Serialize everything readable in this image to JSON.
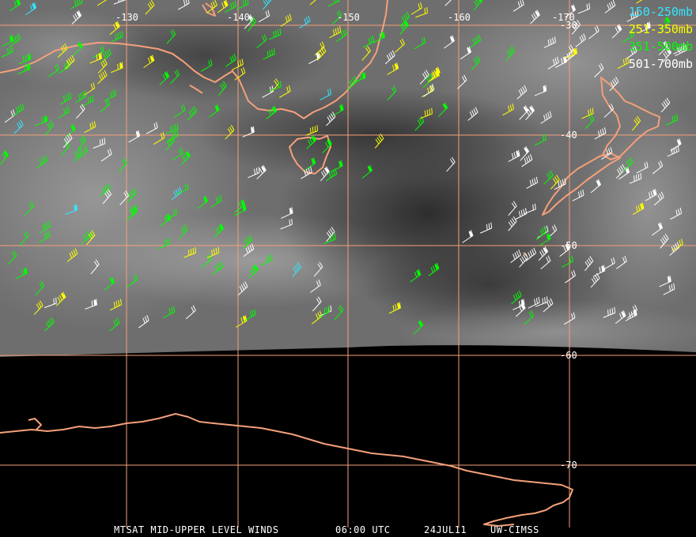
{
  "legend": [
    {
      "label": "150-250mb",
      "color": "#33e6ff"
    },
    {
      "label": "251-350mb",
      "color": "#ffff00"
    },
    {
      "label": "351-500mb",
      "color": "#00ff00"
    },
    {
      "label": "501-700mb",
      "color": "#ffffff"
    }
  ],
  "longitude_labels": [
    "-130",
    "-140",
    "-150",
    "-160",
    "-170"
  ],
  "latitude_labels": [
    "-30",
    "-40",
    "-50",
    "-60",
    "-70"
  ],
  "footer": {
    "product": "MTSAT MID-UPPER LEVEL WINDS",
    "time": "06:00 UTC",
    "date": "24JUL11",
    "credit": "UW-CIMSS"
  },
  "colors": {
    "coastline": "#f4a07a",
    "grid": "#f4a07a",
    "space": "#000000"
  }
}
